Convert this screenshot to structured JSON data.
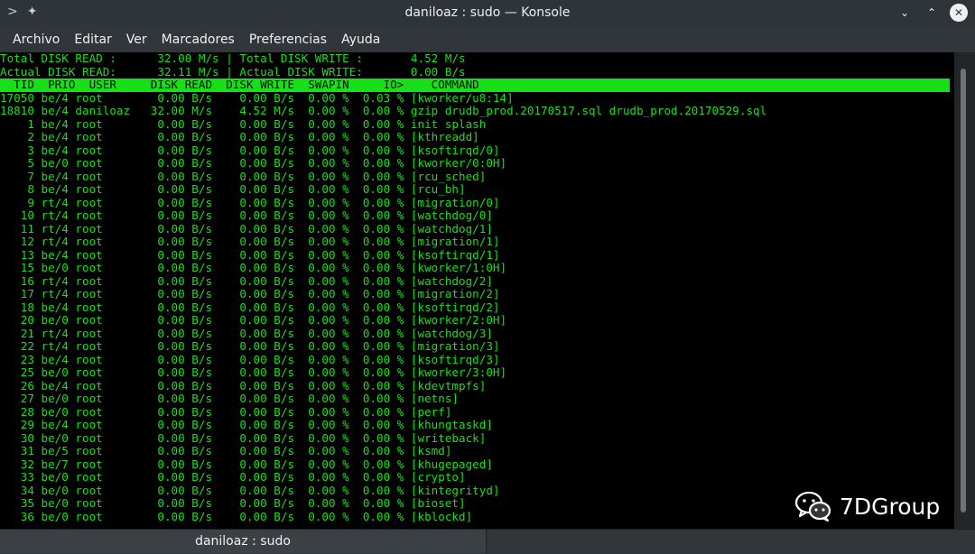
{
  "window": {
    "title": "daniloaz : sudo — Konsole",
    "left_icons": [
      ">",
      "✦"
    ],
    "buttons": [
      "⌄",
      "⌃",
      "✕"
    ]
  },
  "menu": [
    "Archivo",
    "Editar",
    "Ver",
    "Marcadores",
    "Preferencias",
    "Ayuda"
  ],
  "terminal": {
    "summary": [
      "Total DISK READ :      32.00 M/s | Total DISK WRITE :       4.52 M/s",
      "Actual DISK READ:      32.11 M/s | Actual DISK WRITE:       0.00 B/s"
    ],
    "header": "  TID  PRIO  USER     DISK READ  DISK WRITE  SWAPIN     IO>    COMMAND",
    "rows": [
      "17050 be/4 root        0.00 B/s    0.00 B/s  0.00 %  0.03 % [kworker/u8:14]",
      "18810 be/4 daniloaz   32.00 M/s    4.52 M/s  0.00 %  0.00 % gzip drudb_prod.20170517.sql drudb_prod.20170529.sql",
      "    1 be/4 root        0.00 B/s    0.00 B/s  0.00 %  0.00 % init splash",
      "    2 be/4 root        0.00 B/s    0.00 B/s  0.00 %  0.00 % [kthreadd]",
      "    3 be/4 root        0.00 B/s    0.00 B/s  0.00 %  0.00 % [ksoftirqd/0]",
      "    5 be/0 root        0.00 B/s    0.00 B/s  0.00 %  0.00 % [kworker/0:0H]",
      "    7 be/4 root        0.00 B/s    0.00 B/s  0.00 %  0.00 % [rcu_sched]",
      "    8 be/4 root        0.00 B/s    0.00 B/s  0.00 %  0.00 % [rcu_bh]",
      "    9 rt/4 root        0.00 B/s    0.00 B/s  0.00 %  0.00 % [migration/0]",
      "   10 rt/4 root        0.00 B/s    0.00 B/s  0.00 %  0.00 % [watchdog/0]",
      "   11 rt/4 root        0.00 B/s    0.00 B/s  0.00 %  0.00 % [watchdog/1]",
      "   12 rt/4 root        0.00 B/s    0.00 B/s  0.00 %  0.00 % [migration/1]",
      "   13 be/4 root        0.00 B/s    0.00 B/s  0.00 %  0.00 % [ksoftirqd/1]",
      "   15 be/0 root        0.00 B/s    0.00 B/s  0.00 %  0.00 % [kworker/1:0H]",
      "   16 rt/4 root        0.00 B/s    0.00 B/s  0.00 %  0.00 % [watchdog/2]",
      "   17 rt/4 root        0.00 B/s    0.00 B/s  0.00 %  0.00 % [migration/2]",
      "   18 be/4 root        0.00 B/s    0.00 B/s  0.00 %  0.00 % [ksoftirqd/2]",
      "   20 be/0 root        0.00 B/s    0.00 B/s  0.00 %  0.00 % [kworker/2:0H]",
      "   21 rt/4 root        0.00 B/s    0.00 B/s  0.00 %  0.00 % [watchdog/3]",
      "   22 rt/4 root        0.00 B/s    0.00 B/s  0.00 %  0.00 % [migration/3]",
      "   23 be/4 root        0.00 B/s    0.00 B/s  0.00 %  0.00 % [ksoftirqd/3]",
      "   25 be/0 root        0.00 B/s    0.00 B/s  0.00 %  0.00 % [kworker/3:0H]",
      "   26 be/4 root        0.00 B/s    0.00 B/s  0.00 %  0.00 % [kdevtmpfs]",
      "   27 be/0 root        0.00 B/s    0.00 B/s  0.00 %  0.00 % [netns]",
      "   28 be/0 root        0.00 B/s    0.00 B/s  0.00 %  0.00 % [perf]",
      "   29 be/4 root        0.00 B/s    0.00 B/s  0.00 %  0.00 % [khungtaskd]",
      "   30 be/0 root        0.00 B/s    0.00 B/s  0.00 %  0.00 % [writeback]",
      "   31 be/5 root        0.00 B/s    0.00 B/s  0.00 %  0.00 % [ksmd]",
      "   32 be/7 root        0.00 B/s    0.00 B/s  0.00 %  0.00 % [khugepaged]",
      "   33 be/0 root        0.00 B/s    0.00 B/s  0.00 %  0.00 % [crypto]",
      "   34 be/0 root        0.00 B/s    0.00 B/s  0.00 %  0.00 % [kintegrityd]",
      "   35 be/0 root        0.00 B/s    0.00 B/s  0.00 %  0.00 % [bioset]",
      "   36 be/0 root        0.00 B/s    0.00 B/s  0.00 %  0.00 % [kblockd]"
    ]
  },
  "watermark": {
    "icon": "wechat-icon",
    "text": "7DGroup"
  },
  "tab": {
    "label": "daniloaz : sudo"
  },
  "colors": {
    "terminal_fg": "#18e018",
    "terminal_bg": "#000000",
    "chrome": "#31363b"
  }
}
